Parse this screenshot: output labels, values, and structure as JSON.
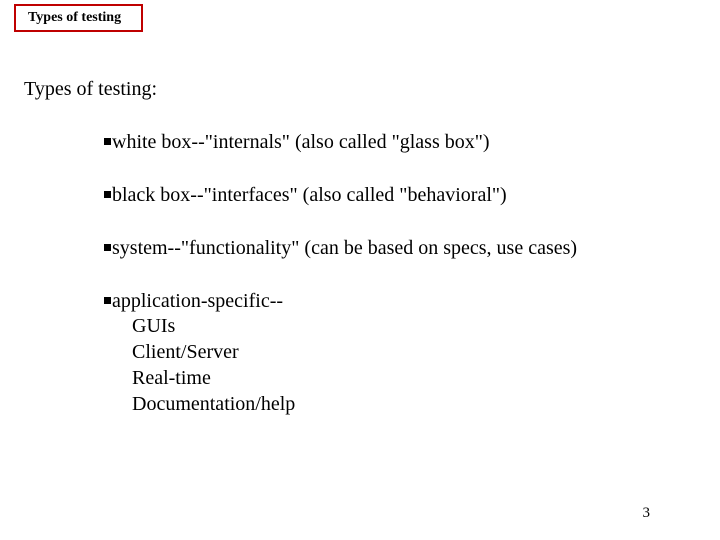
{
  "header": {
    "title": "Types of testing"
  },
  "subtitle": "Types of testing:",
  "bullets": {
    "b1": "white box--\"internals\"  (also called \"glass box\")",
    "b2": "black box--\"interfaces\" (also called \"behavioral\")",
    "b3": "system--\"functionality\" (can be based on specs, use cases)",
    "b4": "application-specific--",
    "sub": {
      "s1": "GUIs",
      "s2": "Client/Server",
      "s3": "Real-time",
      "s4": "Documentation/help"
    }
  },
  "page": "3"
}
